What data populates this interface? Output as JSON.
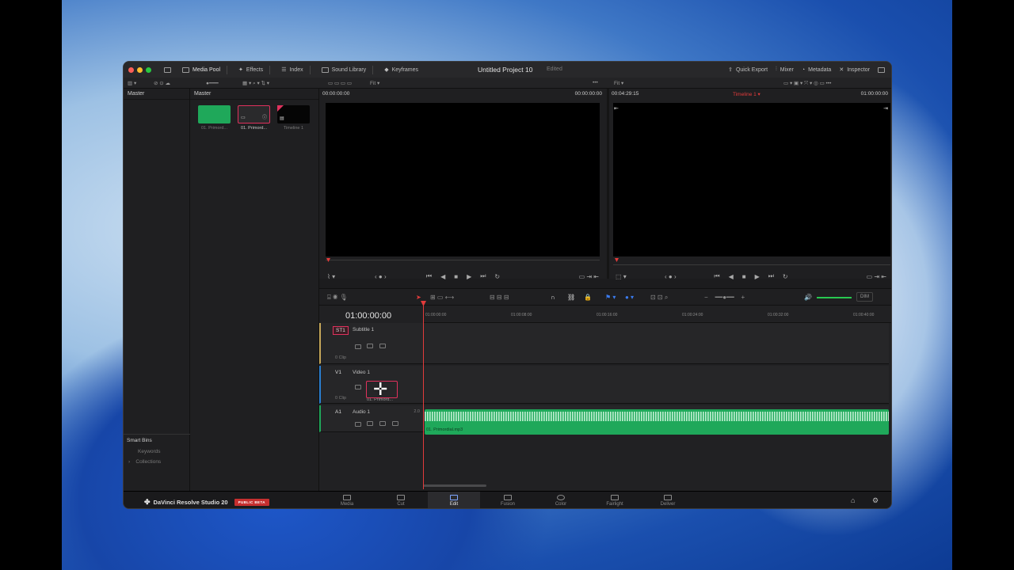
{
  "window": {
    "title": "Untitled Project 10",
    "status": "Edited"
  },
  "titlebar": {
    "media_pool": "Media Pool",
    "effects": "Effects",
    "index": "Index",
    "sound_library": "Sound Library",
    "keyframes": "Keyframes",
    "quick_export": "Quick Export",
    "mixer": "Mixer",
    "metadata": "Metadata",
    "inspector": "Inspector"
  },
  "toolbar": {
    "fit_left": "Fit",
    "fit_right": "Fit"
  },
  "media_pool": {
    "bin_left": "Master",
    "bin_right": "Master",
    "clips": [
      {
        "label": "01. Primord...",
        "kind": "audio"
      },
      {
        "label": "01. Primord...",
        "kind": "selected"
      },
      {
        "label": "Timeline 1",
        "kind": "timeline"
      }
    ],
    "smart_bins": "Smart Bins",
    "keywords": "Keywords",
    "collections": "Collections"
  },
  "source_viewer": {
    "timecode_left": "00:00:00:00",
    "timecode_right": "00:00:00:00"
  },
  "timeline_viewer": {
    "duration": "00:04:29:15",
    "timeline_name": "Timeline 1",
    "timecode": "01:00:00:00"
  },
  "timeline": {
    "current_timecode": "01:00:00:00",
    "ruler": [
      "01:00:00:00",
      "01:00:08:00",
      "01:00:16:00",
      "01:00:24:00",
      "01:00:32:00",
      "01:00:40:00"
    ],
    "dim_label": "DIM",
    "tracks": [
      {
        "id": "ST1",
        "name": "Subtitle 1",
        "clips": "0 Clip"
      },
      {
        "id": "V1",
        "name": "Video 1",
        "clips": "0 Clip",
        "drag_label": "01. Primord..."
      },
      {
        "id": "A1",
        "name": "Audio 1",
        "channels": "2.0",
        "clip_name": "01. Primordial.mp3"
      }
    ]
  },
  "pages": [
    "Media",
    "Cut",
    "Edit",
    "Fusion",
    "Color",
    "Fairlight",
    "Deliver"
  ],
  "active_page": "Edit",
  "app": {
    "name": "DaVinci Resolve Studio 20",
    "badge": "PUBLIC BETA"
  },
  "colors": {
    "accent_red": "#e23b3b",
    "audio_green": "#1fa85a",
    "active_blue": "#2a5fd1"
  }
}
